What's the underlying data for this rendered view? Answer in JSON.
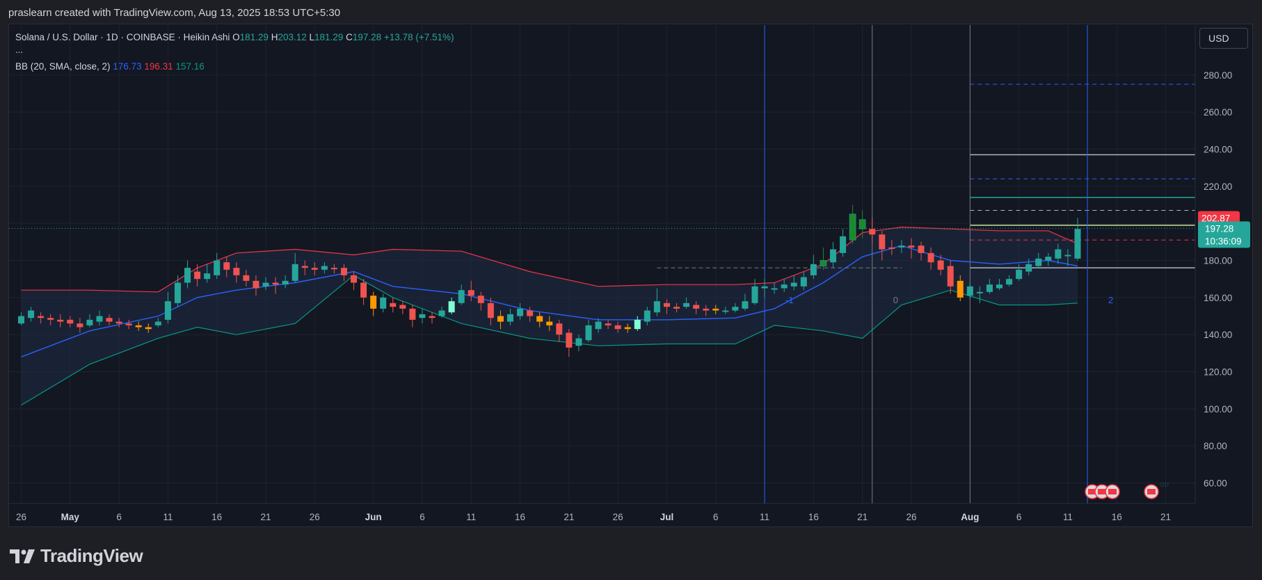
{
  "credit": "praslearn created with TradingView.com, Aug 13, 2025 18:53 UTC+5:30",
  "legend": {
    "symbol": "Solana / U.S. Dollar · 1D · COINBASE · Heikin Ashi",
    "o_label": "O",
    "o": "181.29",
    "h_label": "H",
    "h": "203.12",
    "l_label": "L",
    "l": "181.29",
    "c_label": "C",
    "c": "197.28",
    "change": "+13.78 (+7.51%)",
    "more": "...",
    "bb_label": "BB (20, SMA, close, 2)",
    "bb_basis": "176.73",
    "bb_upper": "196.31",
    "bb_lower": "157.16"
  },
  "currency_button": "USD",
  "brand": "TradingView",
  "colors": {
    "up": "#26a69a",
    "down": "#ef5350",
    "up_light": "#7fffd4",
    "down_orange": "#ff9800",
    "up_dark": "#1b8a2a",
    "basis": "#2962ff",
    "upper": "#f23645",
    "lower": "#089981",
    "fill": "#1f2c45"
  },
  "chart_data": {
    "type": "candlestick",
    "title": "Solana / U.S. Dollar · 1D · COINBASE · Heikin Ashi",
    "ylim": [
      50,
      300
    ],
    "y_ticks": [
      "60.00",
      "80.00",
      "100.00",
      "120.00",
      "140.00",
      "160.00",
      "180.00",
      "200.00",
      "220.00",
      "240.00",
      "260.00",
      "280.00"
    ],
    "x_ticks": [
      {
        "label": "26",
        "date": "2025-04-26"
      },
      {
        "label": "May",
        "date": "2025-05-01"
      },
      {
        "label": "6",
        "date": "2025-05-06"
      },
      {
        "label": "11",
        "date": "2025-05-11"
      },
      {
        "label": "16",
        "date": "2025-05-16"
      },
      {
        "label": "21",
        "date": "2025-05-21"
      },
      {
        "label": "26",
        "date": "2025-05-26"
      },
      {
        "label": "Jun",
        "date": "2025-06-01"
      },
      {
        "label": "6",
        "date": "2025-06-06"
      },
      {
        "label": "11",
        "date": "2025-06-11"
      },
      {
        "label": "16",
        "date": "2025-06-16"
      },
      {
        "label": "21",
        "date": "2025-06-21"
      },
      {
        "label": "26",
        "date": "2025-06-26"
      },
      {
        "label": "Jul",
        "date": "2025-07-01"
      },
      {
        "label": "6",
        "date": "2025-07-06"
      },
      {
        "label": "11",
        "date": "2025-07-11"
      },
      {
        "label": "16",
        "date": "2025-07-16"
      },
      {
        "label": "21",
        "date": "2025-07-21"
      },
      {
        "label": "26",
        "date": "2025-07-26"
      },
      {
        "label": "Aug",
        "date": "2025-08-01"
      },
      {
        "label": "6",
        "date": "2025-08-06"
      },
      {
        "label": "11",
        "date": "2025-08-11"
      },
      {
        "label": "16",
        "date": "2025-08-16"
      },
      {
        "label": "21",
        "date": "2025-08-21"
      }
    ],
    "x_range": [
      "2025-04-26",
      "2025-08-24"
    ],
    "candles": [
      [
        "2025-04-26",
        146,
        150,
        145,
        152,
        "up"
      ],
      [
        "2025-04-27",
        149,
        153,
        147,
        155,
        "up"
      ],
      [
        "2025-04-28",
        150,
        149,
        146,
        152,
        "down"
      ],
      [
        "2025-04-29",
        149,
        148,
        145,
        151,
        "down"
      ],
      [
        "2025-04-30",
        148,
        147,
        144,
        151,
        "down"
      ],
      [
        "2025-05-01",
        148,
        146,
        144,
        150,
        "down"
      ],
      [
        "2025-05-02",
        146,
        144,
        141,
        149,
        "down"
      ],
      [
        "2025-05-03",
        145,
        148,
        144,
        151,
        "up"
      ],
      [
        "2025-05-04",
        147,
        150,
        145,
        153,
        "up"
      ],
      [
        "2025-05-05",
        149,
        147,
        145,
        151,
        "down"
      ],
      [
        "2025-05-06",
        147,
        146,
        144,
        149,
        "down"
      ],
      [
        "2025-05-07",
        146,
        145,
        143,
        148,
        "down"
      ],
      [
        "2025-05-08",
        145,
        144,
        142,
        147,
        "down_o"
      ],
      [
        "2025-05-09",
        144,
        143,
        141,
        146,
        "down_o"
      ],
      [
        "2025-05-10",
        145,
        147,
        144,
        149,
        "up"
      ],
      [
        "2025-05-11",
        148,
        158,
        146,
        163,
        "up"
      ],
      [
        "2025-05-12",
        157,
        168,
        155,
        172,
        "up"
      ],
      [
        "2025-05-13",
        168,
        176,
        165,
        180,
        "up"
      ],
      [
        "2025-05-14",
        174,
        170,
        166,
        178,
        "down"
      ],
      [
        "2025-05-15",
        170,
        173,
        168,
        178,
        "up"
      ],
      [
        "2025-05-16",
        172,
        180,
        170,
        184,
        "up"
      ],
      [
        "2025-05-17",
        179,
        175,
        171,
        182,
        "down"
      ],
      [
        "2025-05-18",
        176,
        172,
        168,
        179,
        "down"
      ],
      [
        "2025-05-19",
        172,
        169,
        166,
        175,
        "down"
      ],
      [
        "2025-05-20",
        169,
        165,
        161,
        172,
        "down"
      ],
      [
        "2025-05-21",
        166,
        168,
        164,
        171,
        "up"
      ],
      [
        "2025-05-22",
        168,
        167,
        162,
        171,
        "down"
      ],
      [
        "2025-05-23",
        167,
        169,
        165,
        172,
        "up"
      ],
      [
        "2025-05-24",
        169,
        178,
        168,
        184,
        "up"
      ],
      [
        "2025-05-25",
        177,
        176,
        172,
        180,
        "down"
      ],
      [
        "2025-05-26",
        176,
        175,
        172,
        179,
        "down"
      ],
      [
        "2025-05-27",
        175,
        177,
        173,
        179,
        "up"
      ],
      [
        "2025-05-28",
        176,
        176,
        173,
        178,
        "down"
      ],
      [
        "2025-05-29",
        176,
        172,
        169,
        178,
        "down"
      ],
      [
        "2025-05-30",
        172,
        168,
        164,
        174,
        "down"
      ],
      [
        "2025-05-31",
        168,
        160,
        156,
        170,
        "down"
      ],
      [
        "2025-06-01",
        161,
        154,
        150,
        163,
        "down_o"
      ],
      [
        "2025-06-02",
        154,
        160,
        152,
        162,
        "up"
      ],
      [
        "2025-06-03",
        157,
        155,
        152,
        160,
        "down"
      ],
      [
        "2025-06-04",
        156,
        154,
        151,
        158,
        "down"
      ],
      [
        "2025-06-05",
        154,
        148,
        144,
        156,
        "down"
      ],
      [
        "2025-06-06",
        149,
        151,
        146,
        154,
        "up"
      ],
      [
        "2025-06-07",
        150,
        149,
        146,
        152,
        "down"
      ],
      [
        "2025-06-08",
        150,
        153,
        149,
        155,
        "up"
      ],
      [
        "2025-06-09",
        152,
        158,
        151,
        160,
        "up_l"
      ],
      [
        "2025-06-10",
        157,
        164,
        156,
        167,
        "up"
      ],
      [
        "2025-06-11",
        164,
        161,
        158,
        169,
        "down"
      ],
      [
        "2025-06-12",
        161,
        157,
        153,
        163,
        "down"
      ],
      [
        "2025-06-13",
        157,
        149,
        145,
        160,
        "down"
      ],
      [
        "2025-06-14",
        150,
        147,
        143,
        153,
        "down_o"
      ],
      [
        "2025-06-15",
        147,
        151,
        145,
        154,
        "up"
      ],
      [
        "2025-06-16",
        150,
        154,
        148,
        157,
        "up"
      ],
      [
        "2025-06-17",
        153,
        150,
        147,
        155,
        "down"
      ],
      [
        "2025-06-18",
        150,
        147,
        144,
        152,
        "down_o"
      ],
      [
        "2025-06-19",
        147,
        145,
        142,
        150,
        "down_o"
      ],
      [
        "2025-06-20",
        146,
        140,
        136,
        148,
        "down"
      ],
      [
        "2025-06-21",
        141,
        133,
        128,
        143,
        "down"
      ],
      [
        "2025-06-22",
        134,
        138,
        131,
        140,
        "up"
      ],
      [
        "2025-06-23",
        137,
        145,
        136,
        148,
        "up"
      ],
      [
        "2025-06-24",
        143,
        147,
        141,
        149,
        "up"
      ],
      [
        "2025-06-25",
        146,
        145,
        143,
        148,
        "down"
      ],
      [
        "2025-06-26",
        145,
        143,
        141,
        147,
        "down"
      ],
      [
        "2025-06-27",
        143,
        144,
        141,
        146,
        "down_o"
      ],
      [
        "2025-06-28",
        143,
        148,
        142,
        150,
        "up_l"
      ],
      [
        "2025-06-29",
        147,
        153,
        145,
        155,
        "up"
      ],
      [
        "2025-06-30",
        152,
        158,
        150,
        165,
        "up"
      ],
      [
        "2025-07-01",
        157,
        155,
        151,
        159,
        "down"
      ],
      [
        "2025-07-02",
        155,
        154,
        152,
        157,
        "down"
      ],
      [
        "2025-07-03",
        155,
        157,
        154,
        160,
        "up"
      ],
      [
        "2025-07-04",
        156,
        154,
        151,
        158,
        "down"
      ],
      [
        "2025-07-05",
        154,
        153,
        150,
        156,
        "down"
      ],
      [
        "2025-07-06",
        153,
        154,
        151,
        156,
        "down_o"
      ],
      [
        "2025-07-07",
        153,
        153,
        151,
        155,
        "up"
      ],
      [
        "2025-07-08",
        153,
        155,
        152,
        157,
        "up"
      ],
      [
        "2025-07-09",
        154,
        158,
        153,
        162,
        "up"
      ],
      [
        "2025-07-10",
        157,
        166,
        156,
        170,
        "up"
      ],
      [
        "2025-07-11",
        165,
        166,
        160,
        170,
        "up"
      ],
      [
        "2025-07-12",
        165,
        165,
        162,
        168,
        "up"
      ],
      [
        "2025-07-13",
        165,
        167,
        163,
        170,
        "up"
      ],
      [
        "2025-07-14",
        166,
        168,
        164,
        172,
        "up"
      ],
      [
        "2025-07-15",
        166,
        171,
        164,
        174,
        "up"
      ],
      [
        "2025-07-16",
        172,
        178,
        170,
        183,
        "up"
      ],
      [
        "2025-07-17",
        177,
        180,
        175,
        187,
        "up_d"
      ],
      [
        "2025-07-18",
        179,
        186,
        176,
        190,
        "up"
      ],
      [
        "2025-07-19",
        184,
        193,
        182,
        197,
        "up"
      ],
      [
        "2025-07-20",
        191,
        205,
        189,
        210,
        "up_d"
      ],
      [
        "2025-07-21",
        202,
        197,
        192,
        207,
        "up_d"
      ],
      [
        "2025-07-22",
        197,
        194,
        189,
        203,
        "down"
      ],
      [
        "2025-07-23",
        194,
        186,
        180,
        196,
        "down"
      ],
      [
        "2025-07-24",
        187,
        187,
        183,
        191,
        "down"
      ],
      [
        "2025-07-25",
        187,
        188,
        184,
        191,
        "up"
      ],
      [
        "2025-07-26",
        188,
        187,
        181,
        192,
        "down"
      ],
      [
        "2025-07-27",
        188,
        184,
        180,
        190,
        "down"
      ],
      [
        "2025-07-28",
        184,
        179,
        175,
        187,
        "down"
      ],
      [
        "2025-07-29",
        180,
        175,
        172,
        183,
        "down"
      ],
      [
        "2025-07-30",
        177,
        166,
        162,
        180,
        "down"
      ],
      [
        "2025-07-31",
        169,
        160,
        158,
        172,
        "down_o"
      ],
      [
        "2025-08-01",
        161,
        166,
        159,
        168,
        "up"
      ],
      [
        "2025-08-02",
        163,
        163,
        157,
        166,
        "up"
      ],
      [
        "2025-08-03",
        163,
        167,
        162,
        170,
        "up"
      ],
      [
        "2025-08-04",
        165,
        167,
        164,
        170,
        "up"
      ],
      [
        "2025-08-05",
        167,
        170,
        166,
        172,
        "up"
      ],
      [
        "2025-08-06",
        170,
        175,
        169,
        178,
        "up"
      ],
      [
        "2025-08-07",
        174,
        178,
        172,
        181,
        "up"
      ],
      [
        "2025-08-08",
        177,
        181,
        176,
        184,
        "up"
      ],
      [
        "2025-08-09",
        180,
        182,
        177,
        184,
        "up"
      ],
      [
        "2025-08-10",
        181,
        186,
        178,
        189,
        "up"
      ],
      [
        "2025-08-11",
        183,
        183,
        177,
        186,
        "up"
      ],
      [
        "2025-08-12",
        181,
        197,
        180,
        203,
        "up"
      ]
    ],
    "bollinger": {
      "dates": [
        "2025-04-26",
        "2025-05-03",
        "2025-05-10",
        "2025-05-14",
        "2025-05-18",
        "2025-05-24",
        "2025-05-30",
        "2025-06-03",
        "2025-06-10",
        "2025-06-17",
        "2025-06-24",
        "2025-07-01",
        "2025-07-08",
        "2025-07-12",
        "2025-07-17",
        "2025-07-21",
        "2025-07-25",
        "2025-07-30",
        "2025-08-04",
        "2025-08-09",
        "2025-08-12"
      ],
      "upper": [
        164,
        164,
        163,
        176,
        184,
        186,
        183,
        186,
        185,
        174,
        166,
        167,
        167,
        168,
        178,
        195,
        198,
        197,
        196,
        196,
        189
      ],
      "basis": [
        128,
        142,
        150,
        160,
        164,
        168,
        174,
        166,
        162,
        153,
        148,
        148,
        149,
        154,
        168,
        182,
        188,
        180,
        178,
        180,
        177
      ],
      "lower": [
        102,
        124,
        138,
        144,
        140,
        146,
        172,
        160,
        146,
        138,
        134,
        135,
        135,
        145,
        142,
        138,
        156,
        164,
        156,
        156,
        157
      ]
    },
    "price_lines": [
      {
        "value": 275,
        "style": "dashed",
        "color": "#2962ff"
      },
      {
        "value": 237,
        "style": "solid",
        "color": "#b2b5be"
      },
      {
        "value": 224,
        "style": "dashed",
        "color": "#2962ff"
      },
      {
        "value": 214,
        "style": "solid",
        "color": "#26a69a"
      },
      {
        "value": 207,
        "style": "dashed",
        "color": "#b2b5be"
      },
      {
        "value": 199,
        "style": "solid",
        "color": "#c8e6a0"
      },
      {
        "value": 191,
        "style": "dashed",
        "color": "#f23645"
      },
      {
        "value": 176,
        "style": "solid",
        "color": "#b2b5be"
      }
    ],
    "vertical_lines": [
      {
        "date": "2025-07-11",
        "label": "-1",
        "color": "#2962ff"
      },
      {
        "date": "2025-07-22",
        "label": "0",
        "color": "#787b86"
      },
      {
        "date": "2025-08-01",
        "label": "",
        "color": "#787b86"
      },
      {
        "date": "2025-08-13",
        "label": "2",
        "color": "#2962ff"
      }
    ],
    "price_label_upper": "202.87",
    "price_label_current": "197.28",
    "price_label_countdown": "10:36:09"
  }
}
